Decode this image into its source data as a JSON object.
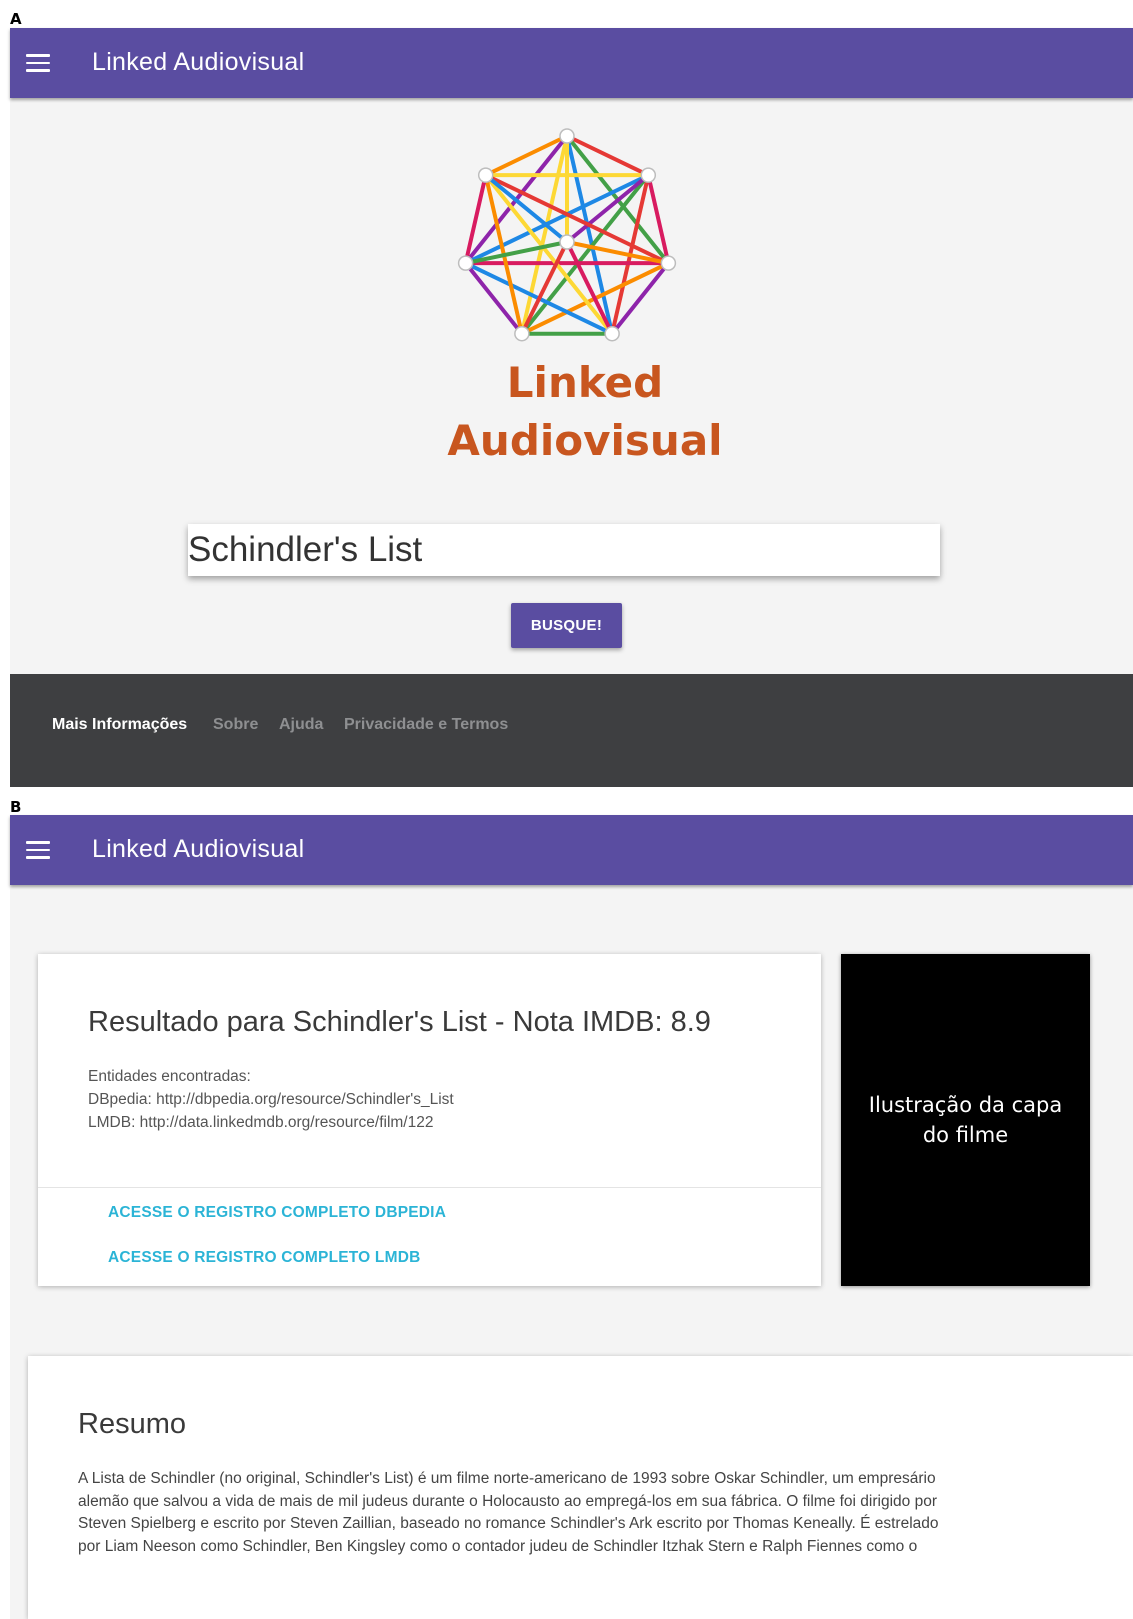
{
  "panel_a": {
    "letter": "A"
  },
  "panel_b": {
    "letter": "B"
  },
  "appbar": {
    "title": "Linked Audiovisual",
    "menu_icon": "hamburger-menu-icon",
    "color": "#5a4da1"
  },
  "logo": {
    "line1": "Linked",
    "line2": "Audiovisual",
    "color": "#c8561f"
  },
  "search": {
    "value": "Schindler's List"
  },
  "search_button": {
    "label": "BUSQUE!"
  },
  "footer": {
    "links": [
      {
        "label": "Mais Informações"
      },
      {
        "label": "Sobre"
      },
      {
        "label": "Ajuda"
      },
      {
        "label": "Privacidade e Termos"
      }
    ]
  },
  "result": {
    "title": "Resultado para Schindler's List - Nota IMDB: 8.9",
    "entities_label": "Entidades encontradas:",
    "dbpedia_line": "DBpedia: http://dbpedia.org/resource/Schindler's_List",
    "lmdb_line": "LMDB: http://data.linkedmdb.org/resource/film/122",
    "link_dbpedia": "ACESSE O REGISTRO COMPLETO DBPEDIA",
    "link_lmdb": "ACESSE O REGISTRO COMPLETO LMDB"
  },
  "cover": {
    "text": "Ilustração da capa do filme"
  },
  "resumo": {
    "title": "Resumo",
    "lines": [
      "A Lista de Schindler (no original, Schindler's List) é um filme norte-americano de 1993 sobre Oskar Schindler, um empresário",
      "alemão que salvou a vida de mais de mil judeus durante o Holocausto ao empregá-los em sua fábrica. O filme foi dirigido por",
      "Steven Spielberg e escrito por Steven Zaillian, baseado no romance Schindler's Ark escrito por Thomas Keneally. É estrelado",
      "por Liam Neeson como Schindler, Ben Kingsley como o contador judeu de Schindler Itzhak Stern e Ralph Fiennes como o"
    ]
  }
}
